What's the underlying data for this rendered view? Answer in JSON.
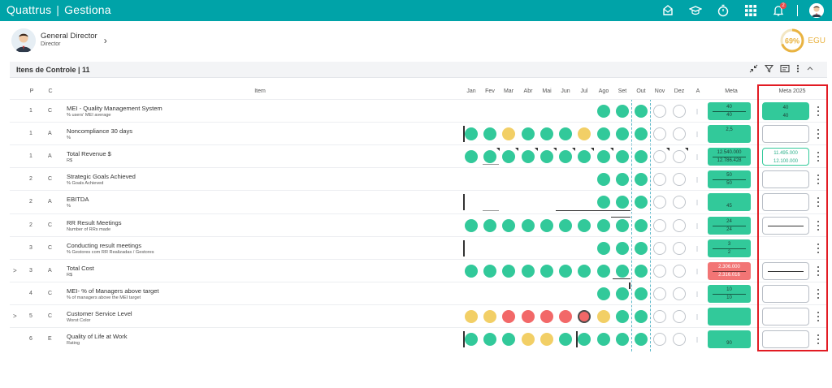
{
  "app": {
    "brand": "Quattrus",
    "module": "Gestiona"
  },
  "profile": {
    "name": "General Director",
    "role": "Director"
  },
  "egu": {
    "percent": "69%",
    "label": "EGU",
    "value": 0.69,
    "color": "#e9b341"
  },
  "panel": {
    "title": "Itens de Controle | 11"
  },
  "columns": {
    "p": "P",
    "c": "C",
    "item": "Item",
    "months": [
      "Jan",
      "Fev",
      "Mar",
      "Abr",
      "Mai",
      "Jun",
      "Jul",
      "Ago",
      "Set",
      "Out",
      "Nov",
      "Dez"
    ],
    "a": "A",
    "meta": "Meta",
    "meta2025": "Meta 2025"
  },
  "colors": {
    "green": "#32c99a",
    "yellow": "#f2cf66",
    "red": "#f26868",
    "teal": "#00a3a8",
    "highlight": "#e21b23"
  },
  "rows": [
    {
      "p": "1",
      "c": "C",
      "name": "MEI - Quality Management System",
      "sub": "% users' MEI average",
      "expand": "",
      "months": [
        "-",
        "-",
        "-",
        "-",
        "-",
        "-",
        "-",
        "g",
        "g",
        "g",
        "e",
        "e"
      ],
      "meta": [
        "40",
        "40"
      ],
      "meta_color": "green",
      "m25": [
        "40",
        "40"
      ],
      "m25_style": "green"
    },
    {
      "p": "1",
      "c": "A",
      "name": "Noncompliance 30 days",
      "sub": "%",
      "expand": "",
      "months": [
        "g",
        "g",
        "y",
        "g",
        "g",
        "g",
        "y",
        "g",
        "g",
        "g",
        "e",
        "e"
      ],
      "meta": [
        "2,5",
        ""
      ],
      "meta_color": "green",
      "m25": [
        "",
        ""
      ],
      "m25_style": "empty"
    },
    {
      "p": "1",
      "c": "A",
      "name": "Total Revenue $",
      "sub": "R$",
      "expand": "",
      "months": [
        "g",
        "g",
        "g",
        "g",
        "g",
        "g",
        "g",
        "g",
        "g",
        "g",
        "e",
        "e"
      ],
      "meta": [
        "12.540.000",
        "12.786.428"
      ],
      "meta_color": "green",
      "m25": [
        "11.495.000",
        "12.100.000"
      ],
      "m25_style": "tealtxt"
    },
    {
      "p": "2",
      "c": "C",
      "name": "Strategic Goals Achieved",
      "sub": "% Goals Achieved",
      "expand": "",
      "months": [
        "-",
        "-",
        "-",
        "-",
        "-",
        "-",
        "-",
        "g",
        "g",
        "g",
        "e",
        "e"
      ],
      "meta": [
        "50",
        "50"
      ],
      "meta_color": "green",
      "m25": [
        "",
        ""
      ],
      "m25_style": "empty"
    },
    {
      "p": "2",
      "c": "A",
      "name": "EBITDA",
      "sub": "%",
      "expand": "",
      "months": [
        "-",
        "-",
        "-",
        "-",
        "-",
        "-",
        "-",
        "g",
        "g",
        "g",
        "e",
        "e"
      ],
      "meta": [
        "",
        "45"
      ],
      "meta_color": "green",
      "m25": [
        "",
        ""
      ],
      "m25_style": "empty"
    },
    {
      "p": "2",
      "c": "C",
      "name": "RR Result Meetings",
      "sub": "Number of RRs made",
      "expand": "",
      "months": [
        "g",
        "g",
        "g",
        "g",
        "g",
        "g",
        "g",
        "g",
        "g",
        "g",
        "e",
        "e"
      ],
      "meta": [
        "24",
        "24"
      ],
      "meta_color": "green",
      "m25": [
        "",
        ""
      ],
      "m25_style": "line"
    },
    {
      "p": "3",
      "c": "C",
      "name": "Conducting result meetings",
      "sub": "% Gestores com RR Realizadas / Gestores",
      "expand": "",
      "months": [
        "-",
        "-",
        "-",
        "-",
        "-",
        "-",
        "-",
        "g",
        "g",
        "g",
        "e",
        "e"
      ],
      "meta": [
        "3",
        "2"
      ],
      "meta_color": "green",
      "m25": [
        "",
        ""
      ],
      "m25_style": "none"
    },
    {
      "p": "3",
      "c": "A",
      "name": "Total Cost",
      "sub": "R$",
      "expand": ">",
      "months": [
        "g",
        "g",
        "g",
        "g",
        "g",
        "g",
        "g",
        "g",
        "g",
        "g",
        "e",
        "e"
      ],
      "meta": [
        "2.306.000",
        "2.316.016"
      ],
      "meta_color": "red",
      "m25": [
        "",
        ""
      ],
      "m25_style": "line"
    },
    {
      "p": "4",
      "c": "C",
      "name": "MEI- % of Managers above target",
      "sub": "% of managers above the MEI target",
      "expand": "",
      "months": [
        "-",
        "-",
        "-",
        "-",
        "-",
        "-",
        "-",
        "g",
        "g",
        "g",
        "e",
        "e"
      ],
      "meta": [
        "10",
        "10"
      ],
      "meta_color": "green",
      "m25": [
        "",
        ""
      ],
      "m25_style": "empty"
    },
    {
      "p": "5",
      "c": "C",
      "name": "Customer Service Level",
      "sub": "Worst Color",
      "expand": ">",
      "months": [
        "y",
        "y",
        "r",
        "r",
        "r",
        "r",
        "rb",
        "y",
        "g",
        "g",
        "e",
        "e"
      ],
      "meta": [
        "",
        ""
      ],
      "meta_color": "green",
      "m25": [
        "",
        ""
      ],
      "m25_style": "empty"
    },
    {
      "p": "6",
      "c": "E",
      "name": "Quality of Life at Work",
      "sub": "Rating",
      "expand": "",
      "months": [
        "g",
        "g",
        "g",
        "y",
        "y",
        "g",
        "g",
        "g",
        "g",
        "g",
        "e",
        "e"
      ],
      "meta": [
        "",
        "90"
      ],
      "meta_color": "green",
      "m25": [
        "",
        ""
      ],
      "m25_style": "empty"
    }
  ]
}
